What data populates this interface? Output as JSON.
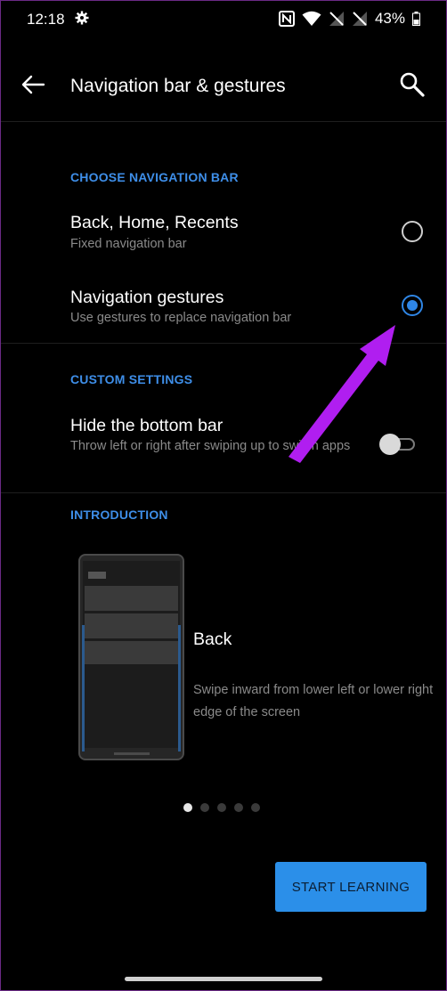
{
  "status_bar": {
    "time": "12:18",
    "battery_text": "43%"
  },
  "app_bar": {
    "title": "Navigation bar & gestures"
  },
  "choose_navigation": {
    "header": "CHOOSE NAVIGATION BAR",
    "options": [
      {
        "title": "Back, Home, Recents",
        "subtitle": "Fixed navigation bar",
        "selected": false
      },
      {
        "title": "Navigation gestures",
        "subtitle": "Use gestures to replace navigation bar",
        "selected": true
      }
    ]
  },
  "custom_settings": {
    "header": "CUSTOM SETTINGS",
    "hide_bottom_bar": {
      "title": "Hide the bottom bar",
      "subtitle": "Throw left or right after swiping up to switch apps",
      "enabled": false
    }
  },
  "introduction": {
    "header": "INTRODUCTION",
    "title": "Back",
    "description": "Swipe inward from lower left or lower right edge of the screen",
    "page_count": 5,
    "current_page": 1
  },
  "start_button": {
    "label": "START LEARNING"
  },
  "colors": {
    "accent": "#2f86e6",
    "annotation_arrow": "#b01ef0"
  }
}
